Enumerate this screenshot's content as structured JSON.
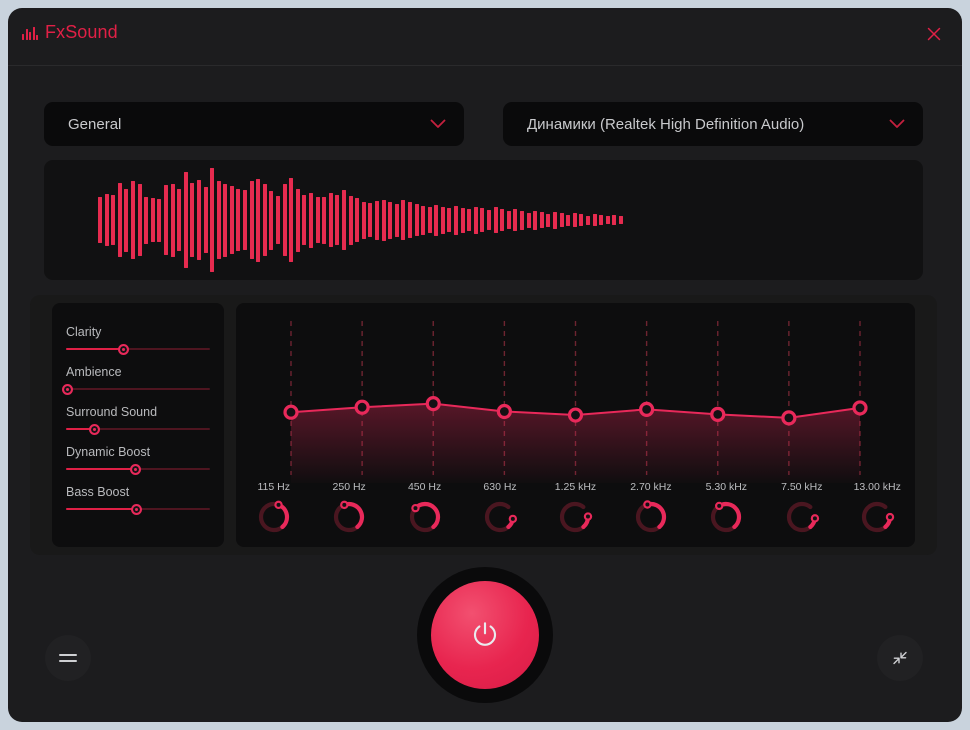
{
  "app": {
    "title": "FxSound",
    "logo_icon": "equalizer-bars-icon",
    "accent_color": "#e02046",
    "accent_bright": "#e8295a",
    "panel_color": "#0d0d0e",
    "background_color": "#1c1c1e"
  },
  "titlebar": {
    "close_icon": "close-icon"
  },
  "preset": {
    "label": "General",
    "chevron_icon": "chevron-down-icon"
  },
  "device": {
    "label": "Динамики (Realtek High Definition Audio)",
    "chevron_icon": "chevron-down-icon"
  },
  "waveform": {
    "bars": [
      46,
      52,
      50,
      74,
      63,
      78,
      72,
      47,
      44,
      43,
      70,
      73,
      62,
      96,
      74,
      80,
      66,
      104,
      78,
      73,
      68,
      62,
      60,
      78,
      83,
      72,
      59,
      48,
      72,
      84,
      63,
      50,
      55,
      46,
      47,
      54,
      50,
      60,
      49,
      44,
      37,
      34,
      39,
      41,
      37,
      33,
      40,
      36,
      32,
      29,
      26,
      31,
      27,
      24,
      29,
      25,
      22,
      27,
      24,
      20,
      26,
      22,
      18,
      22,
      19,
      15,
      19,
      16,
      13,
      17,
      14,
      11,
      14,
      12,
      9,
      12,
      10,
      8,
      10,
      8
    ]
  },
  "sliders": [
    {
      "label": "Clarity",
      "value": 40
    },
    {
      "label": "Ambience",
      "value": 1
    },
    {
      "label": "Surround Sound",
      "value": 20
    },
    {
      "label": "Dynamic Boost",
      "value": 48
    },
    {
      "label": "Bass Boost",
      "value": 49
    }
  ],
  "chart_data": {
    "type": "line",
    "title": "",
    "xlabel": "",
    "ylabel": "",
    "grid": true,
    "legend": "none",
    "categories": [
      "115 Hz",
      "250 Hz",
      "450 Hz",
      "630 Hz",
      "1.25 kHz",
      "2.70 kHz",
      "5.30 kHz",
      "7.50 kHz",
      "13.00 kHz"
    ],
    "series": [
      {
        "name": "Equalizer gain",
        "values": [
          0.46,
          0.53,
          0.58,
          0.47,
          0.42,
          0.5,
          0.43,
          0.38,
          0.52
        ]
      }
    ],
    "ylim": [
      0,
      1
    ]
  },
  "eq_bands": [
    {
      "freq": "115 Hz",
      "knob": 0.46
    },
    {
      "freq": "250 Hz",
      "knob": 0.62
    },
    {
      "freq": "450 Hz",
      "knob": 0.72
    },
    {
      "freq": "630 Hz",
      "knob": 0.16
    },
    {
      "freq": "1.25 kHz",
      "knob": 0.2
    },
    {
      "freq": "2.70 kHz",
      "knob": 0.6
    },
    {
      "freq": "5.30 kHz",
      "knob": 0.66
    },
    {
      "freq": "7.50 kHz",
      "knob": 0.17
    },
    {
      "freq": "13.00 kHz",
      "knob": 0.19
    }
  ],
  "bottom": {
    "power_icon": "power-icon",
    "menu_icon": "hamburger-menu-icon",
    "collapse_icon": "collapse-arrows-icon"
  }
}
